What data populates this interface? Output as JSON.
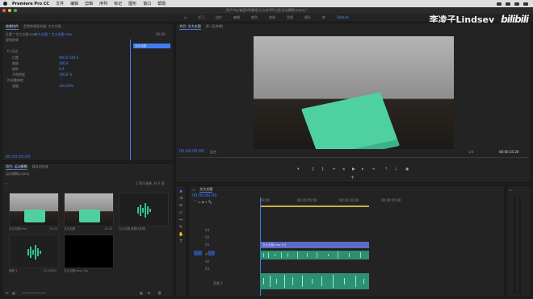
{
  "menubar": {
    "app": "Premiere Pro CC",
    "items": [
      "文件",
      "编辑",
      "剪辑",
      "序列",
      "标记",
      "图形",
      "窗口",
      "帮助"
    ]
  },
  "titlebar": {
    "path": "/用户/lsy/桌面/AE教程/立方体/PR工程/运动模糊.prproj *"
  },
  "workspace": {
    "tabs": [
      "编辑",
      "颜色",
      "效果",
      "音频",
      "图形",
      "库"
    ],
    "active_label": "Default",
    "prefix_tabs": [
      "学习",
      "组件",
      "编辑",
      "颜色"
    ]
  },
  "brand": {
    "name": "李凌子Lindsey",
    "logo": "bilibili"
  },
  "effect_controls": {
    "tabs": [
      "效果控件",
      "音频剪辑混合器: 文大文图"
    ],
    "source_line": "主要 * 文大文图.mov",
    "sequence_line": "文大文图 * 文大文图.mov",
    "timecode_right": "00;00",
    "section_video": "视频效果",
    "rows": [
      {
        "label": "fx 运动",
        "value": ""
      },
      {
        "label": "位置",
        "value": "960.0  540.0"
      },
      {
        "label": "缩放",
        "value": "100.0"
      },
      {
        "label": "旋转",
        "value": "0.0"
      },
      {
        "label": "不透明度",
        "value": "100.0 %"
      },
      {
        "label": "时间重映射",
        "value": ""
      },
      {
        "label": "速度",
        "value": "100.00%"
      }
    ],
    "clip_label": "文大文图",
    "timecode": "00:00:00:00"
  },
  "program_monitor": {
    "tabs": [
      "节目: 文大文图",
      "源: (无剪辑)"
    ],
    "timecode": "00:00:00:00",
    "fit": "适合",
    "duration": "00:00:15:20",
    "quality": "1/4"
  },
  "project_panel": {
    "tabs": [
      "项目: 运动模糊",
      "媒体浏览器"
    ],
    "file": "运动模糊.prproj",
    "count": "1 项已选择, 共 6 项",
    "items": [
      {
        "name": "文大文图.mov",
        "duration": "15:20"
      },
      {
        "name": "文大文图",
        "duration": "15:20"
      },
      {
        "name": "文大文图 音频已处理",
        "duration": "15:10420"
      },
      {
        "name": "音频 1",
        "duration": "11:10950"
      },
      {
        "name": "文大文图.mov 10s",
        "duration": "1 0"
      }
    ]
  },
  "timeline": {
    "tab": "文大文图",
    "timecode": "00:00:00:00",
    "ruler": [
      "00:00",
      "00:00:05:00",
      "00:00:10:00",
      "00:00:15:00"
    ],
    "tracks": [
      "V3",
      "V2",
      "V1",
      "A1",
      "A2",
      "A3",
      "音频 5"
    ],
    "clip_label": "文大文图.mov [V]",
    "master_label": "主声道"
  },
  "colors": {
    "accent": "#3d7cf0",
    "video_clip": "#5c6bc4",
    "audio_clip": "#2f8f72",
    "cube": "#4fd0a3"
  }
}
